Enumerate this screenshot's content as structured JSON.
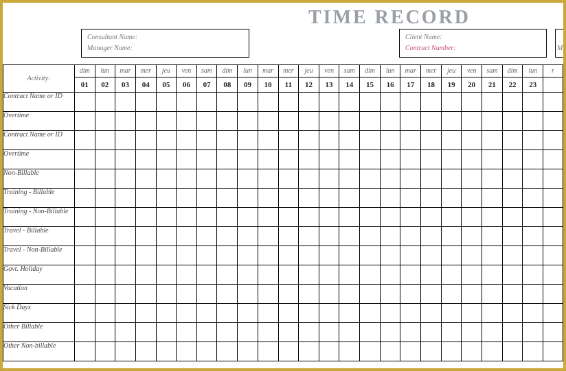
{
  "title": "TIME  RECORD",
  "info_left": {
    "line1_label": "Consultant Name:",
    "line2_label": "Manager Name:"
  },
  "info_right": {
    "line1_label": "Client Name:",
    "line2_label": "Contract Number:"
  },
  "info_cut": {
    "bottom_letter": "M"
  },
  "activity_header": "Activity:",
  "day_abbrs": [
    "dim",
    "lun",
    "mar",
    "mer",
    "jeu",
    "ven",
    "sam",
    "dim",
    "lun",
    "mar",
    "mer",
    "jeu",
    "ven",
    "sam",
    "dim",
    "lun",
    "mar",
    "mer",
    "jeu",
    "ven",
    "sam",
    "dim",
    "lun",
    "r"
  ],
  "day_nums": [
    "01",
    "02",
    "03",
    "04",
    "05",
    "06",
    "07",
    "08",
    "09",
    "10",
    "11",
    "12",
    "13",
    "14",
    "15",
    "16",
    "17",
    "18",
    "19",
    "20",
    "21",
    "22",
    "23",
    ""
  ],
  "activities": [
    "Contract Name or ID",
    "Overtime",
    "Contract Name or ID",
    "Overtime",
    "Non-Billable",
    "Training - Billable",
    "Training - Non-Billable",
    "Travel - Billable",
    "Travel - Non-Billable",
    "Govt. Holiday",
    "Vacation",
    "Sick Days",
    "Other Billable",
    "Other Non-billable"
  ]
}
